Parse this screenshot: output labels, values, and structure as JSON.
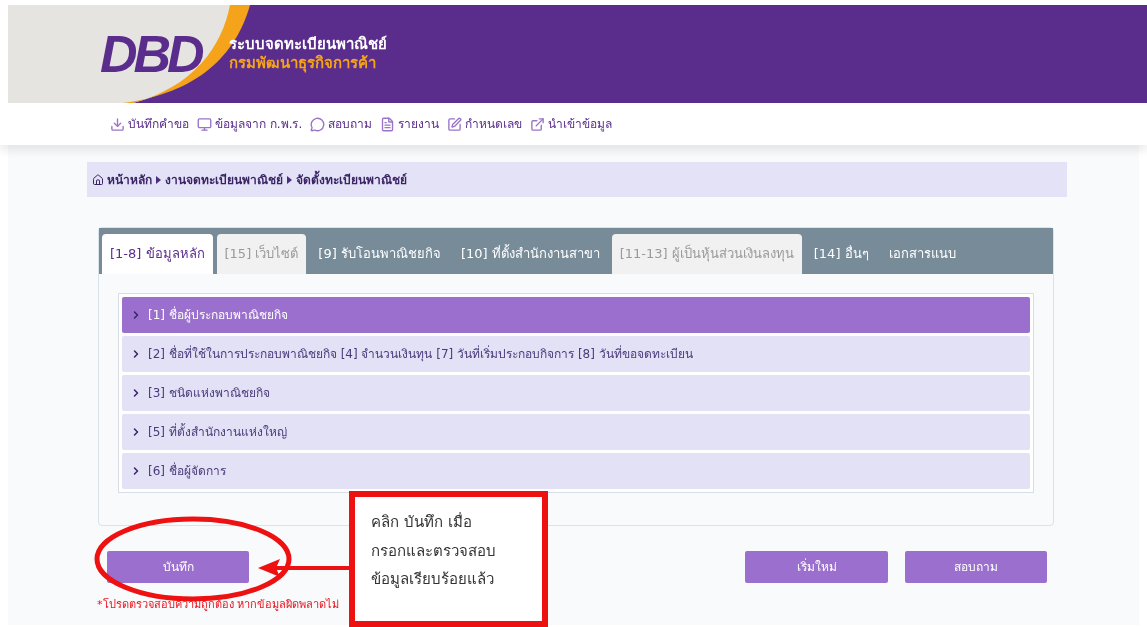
{
  "header": {
    "logo": "DBD",
    "title": "ระบบจดทะเบียนพาณิชย์",
    "subtitle": "กรมพัฒนาธุรกิจการค้า"
  },
  "toolbar": [
    {
      "kind": "download",
      "label": "บันทึกคำขอ"
    },
    {
      "kind": "monitor",
      "label": "ข้อมูลจาก ก.พ.ร."
    },
    {
      "kind": "chat",
      "label": "สอบถาม"
    },
    {
      "kind": "file",
      "label": "รายงาน"
    },
    {
      "kind": "edit",
      "label": "กำหนดเลข"
    },
    {
      "kind": "import",
      "label": "นำเข้าข้อมูล"
    }
  ],
  "breadcrumb": [
    "หน้าหลัก",
    "งานจดทะเบียนพาณิชย์",
    "จัดตั้งทะเบียนพาณิชย์"
  ],
  "tabs": [
    {
      "label": "[1-8] ข้อมูลหลัก",
      "selected": true,
      "disabled": false
    },
    {
      "label": "[15] เว็บไซต์",
      "selected": false,
      "disabled": true
    },
    {
      "label": "[9] รับโอนพาณิชยกิจ",
      "selected": false,
      "disabled": false
    },
    {
      "label": "[10] ที่ตั้งสำนักงานสาขา",
      "selected": false,
      "disabled": false
    },
    {
      "label": "[11-13] ผู้เป็นหุ้นส่วนเงินลงทุน",
      "selected": false,
      "disabled": true
    },
    {
      "label": "[14] อื่นๆ",
      "selected": false,
      "disabled": false
    },
    {
      "label": "เอกสารแนบ",
      "selected": false,
      "disabled": false
    }
  ],
  "sections": [
    {
      "label": "[1] ชื่อผู้ประกอบพาณิชยกิจ",
      "selected": true
    },
    {
      "label": "[2] ชื่อที่ใช้ในการประกอบพาณิชยกิจ [4] จำนวนเงินทุน [7] วันที่เริ่มประกอบกิจการ [8] วันที่ขอจดทะเบียน",
      "selected": false
    },
    {
      "label": "[3] ชนิดแห่งพาณิชยกิจ",
      "selected": false
    },
    {
      "label": "[5] ที่ตั้งสำนักงานแห่งใหญ่",
      "selected": false
    },
    {
      "label": "[6] ชื่อผู้จัดการ",
      "selected": false
    }
  ],
  "buttons": {
    "save": "บันทึก",
    "reset": "เริ่มใหม่",
    "inquire": "สอบถาม"
  },
  "note": "*โปรดตรวจสอบความถูกต้อง หากข้อมูลผิดพลาดไม่",
  "annotation": {
    "lines": [
      "คลิก บันทึก เมื่อ",
      "กรอกและตรวจสอบ",
      "ข้อมูลเรียบร้อยแล้ว"
    ]
  }
}
